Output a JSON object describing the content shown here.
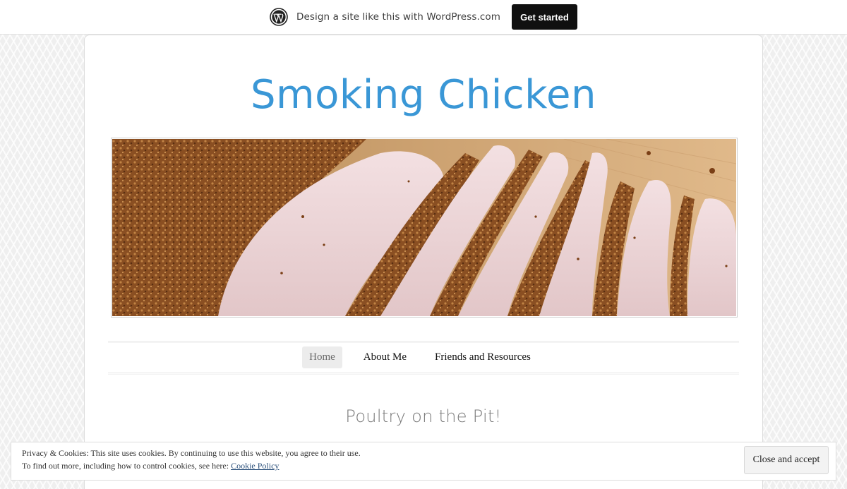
{
  "promo": {
    "text": "Design a site like this with WordPress.com",
    "button_label": "Get started",
    "logo_icon": "wordpress-logo-icon"
  },
  "site": {
    "title": "Smoking Chicken",
    "title_color": "#3a97d6"
  },
  "nav": {
    "items": [
      {
        "label": "Home",
        "active": true
      },
      {
        "label": "About Me",
        "active": false
      },
      {
        "label": "Friends and Resources",
        "active": false
      }
    ]
  },
  "post": {
    "title": "Poultry on the Pit!"
  },
  "cookie_banner": {
    "line1": "Privacy & Cookies: This site uses cookies. By continuing to use this website, you agree to their use.",
    "line2_prefix": "To find out more, including how to control cookies, see here: ",
    "link_text": "Cookie Policy",
    "button_label": "Close and accept"
  }
}
